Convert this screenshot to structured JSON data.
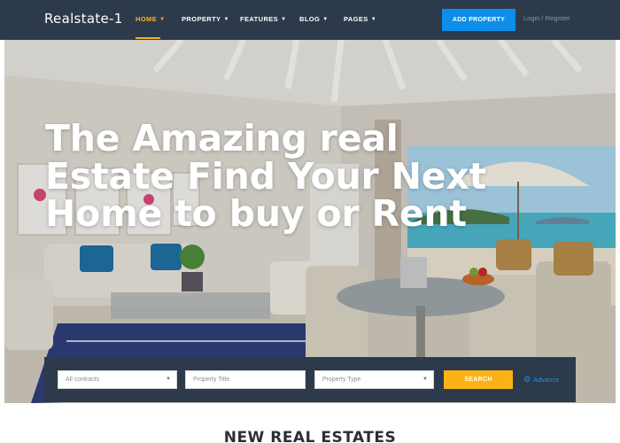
{
  "brand": "Realstate-1",
  "nav": {
    "items": [
      {
        "label": "HOME"
      },
      {
        "label": "PROPERTY"
      },
      {
        "label": "FEATURES"
      },
      {
        "label": "BLOG"
      },
      {
        "label": "PAGES"
      }
    ],
    "active": "HOME",
    "add_property": "ADD PROPERTY",
    "login": "Login / Register"
  },
  "hero": {
    "headline": [
      "The Amazing real",
      "Estate Find Your Next",
      "Home to buy or Rent"
    ]
  },
  "search": {
    "contract_value": "All contracts",
    "title_placeholder": "Property Title",
    "type_value": "Property Type",
    "button": "SEARCH",
    "advance": "Advance"
  },
  "section_title": "NEW REAL ESTATES",
  "colors": {
    "navbar": "#2d3a4b",
    "accent": "#f6b51e",
    "primary_button": "#0d8ee8",
    "search_button": "#fbb217",
    "link": "#1e8fe1"
  },
  "icons": [
    "caret-down-icon",
    "gear-icon"
  ]
}
